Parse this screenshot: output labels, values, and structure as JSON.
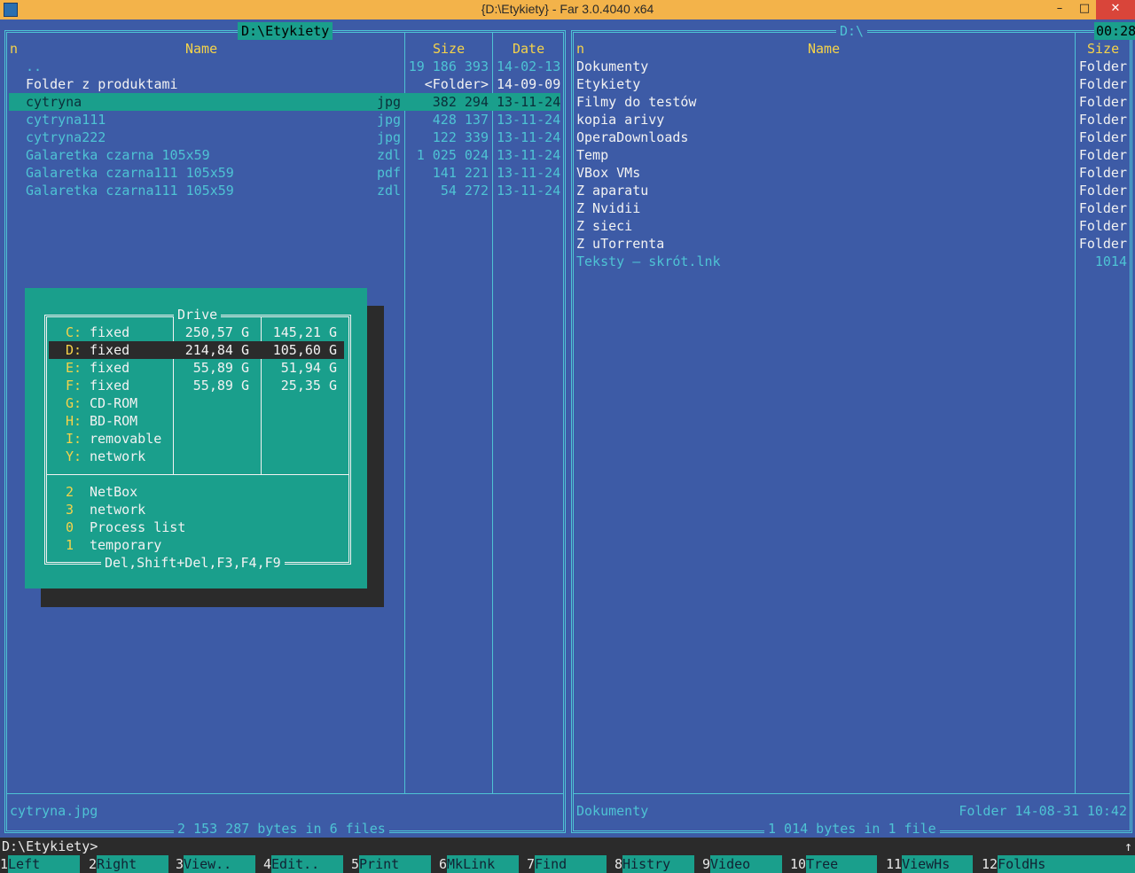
{
  "window": {
    "title": "{D:\\Etykiety} - Far 3.0.4040 x64",
    "minimize": "–",
    "maximize": "□",
    "close": "✕"
  },
  "left_panel": {
    "title": "D:\\Etykiety",
    "col_n": "n",
    "col_name": "Name",
    "col_size": "Size",
    "col_date": "Date",
    "files": [
      {
        "name": "..",
        "ext": "",
        "size": "19 186 393",
        "date": "14-02-13"
      },
      {
        "name": "Folder z produktami",
        "ext": "",
        "size": "<Folder>",
        "date": "14-09-09"
      },
      {
        "name": "cytryna",
        "ext": "jpg",
        "size": "382 294",
        "date": "13-11-24"
      },
      {
        "name": "cytryna111",
        "ext": "jpg",
        "size": "428 137",
        "date": "13-11-24"
      },
      {
        "name": "cytryna222",
        "ext": "jpg",
        "size": "122 339",
        "date": "13-11-24"
      },
      {
        "name": "Galaretka czarna 105x59",
        "ext": "zdl",
        "size": "1 025 024",
        "date": "13-11-24"
      },
      {
        "name": "Galaretka czarna111 105x59",
        "ext": "pdf",
        "size": "141 221",
        "date": "13-11-24"
      },
      {
        "name": "Galaretka czarna111 105x59",
        "ext": "zdl",
        "size": "54 272",
        "date": "13-11-24"
      }
    ],
    "status_file": "cytryna.jpg",
    "summary": "2 153 287 bytes in 6 files"
  },
  "right_panel": {
    "title": "D:\\",
    "clock": "00:28",
    "col_n": "n",
    "col_name": "Name",
    "col_size": "Size",
    "files": [
      {
        "name": "Dokumenty",
        "size": "Folder"
      },
      {
        "name": "Etykiety",
        "size": "Folder"
      },
      {
        "name": "Filmy do testów",
        "size": "Folder"
      },
      {
        "name": "kopia arivy",
        "size": "Folder"
      },
      {
        "name": "OperaDownloads",
        "size": "Folder"
      },
      {
        "name": "Temp",
        "size": "Folder"
      },
      {
        "name": "VBox VMs",
        "size": "Folder"
      },
      {
        "name": "Z aparatu",
        "size": "Folder"
      },
      {
        "name": "Z Nvidii",
        "size": "Folder"
      },
      {
        "name": "Z sieci",
        "size": "Folder"
      },
      {
        "name": "Z uTorrenta",
        "size": "Folder"
      },
      {
        "name": "Teksty – skrót.lnk",
        "size": "1014"
      }
    ],
    "status_file": "Dokumenty",
    "status_info": "Folder 14-08-31 10:42",
    "summary": "1 014 bytes in 1 file"
  },
  "drive_menu": {
    "title": "Drive",
    "drives": [
      {
        "letter": "C:",
        "type": "fixed",
        "total": "250,57 G",
        "free": "145,21 G"
      },
      {
        "letter": "D:",
        "type": "fixed",
        "total": "214,84 G",
        "free": "105,60 G"
      },
      {
        "letter": "E:",
        "type": "fixed",
        "total": "55,89 G",
        "free": "51,94 G"
      },
      {
        "letter": "F:",
        "type": "fixed",
        "total": "55,89 G",
        "free": "25,35 G"
      },
      {
        "letter": "G:",
        "type": "CD-ROM",
        "total": "",
        "free": ""
      },
      {
        "letter": "H:",
        "type": "BD-ROM",
        "total": "",
        "free": ""
      },
      {
        "letter": "I:",
        "type": "removable",
        "total": "",
        "free": ""
      },
      {
        "letter": "Y:",
        "type": "network",
        "total": "",
        "free": ""
      }
    ],
    "plugins": [
      {
        "key": "2",
        "label": "NetBox"
      },
      {
        "key": "3",
        "label": "network"
      },
      {
        "key": "0",
        "label": "Process list"
      },
      {
        "key": "1",
        "label": "temporary"
      }
    ],
    "footer": "Del,Shift+Del,F3,F4,F9"
  },
  "command_line": {
    "prompt": "D:\\Etykiety>",
    "scroll_marker": "↑"
  },
  "keybar": [
    {
      "num": "1",
      "label": "Left"
    },
    {
      "num": "2",
      "label": "Right"
    },
    {
      "num": "3",
      "label": "View.."
    },
    {
      "num": "4",
      "label": "Edit.."
    },
    {
      "num": "5",
      "label": "Print"
    },
    {
      "num": "6",
      "label": "MkLink"
    },
    {
      "num": "7",
      "label": "Find"
    },
    {
      "num": "8",
      "label": "Histry"
    },
    {
      "num": "9",
      "label": "Video"
    },
    {
      "num": "10",
      "label": "Tree"
    },
    {
      "num": "11",
      "label": "ViewHs"
    },
    {
      "num": "12",
      "label": "FoldHs"
    }
  ]
}
